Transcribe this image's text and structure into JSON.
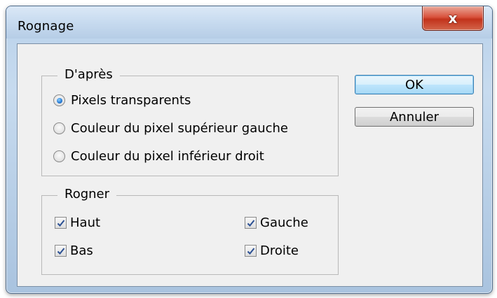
{
  "dialog": {
    "title": "Rognage",
    "close_glyph": "x"
  },
  "based_on": {
    "legend": "D'après",
    "options": [
      {
        "label": "Pixels transparents",
        "selected": true
      },
      {
        "label": "Couleur du pixel supérieur gauche",
        "selected": false
      },
      {
        "label": "Couleur du pixel inférieur droit",
        "selected": false
      }
    ]
  },
  "trim": {
    "legend": "Rogner",
    "top": {
      "label": "Haut",
      "checked": true
    },
    "bottom": {
      "label": "Bas",
      "checked": true
    },
    "left": {
      "label": "Gauche",
      "checked": true
    },
    "right": {
      "label": "Droite",
      "checked": true
    }
  },
  "buttons": {
    "ok": "OK",
    "cancel": "Annuler"
  },
  "colors": {
    "check_mark": "#2a4f93",
    "radio_selected": "#2b7fd6",
    "close_button": "#c2331c",
    "default_button_border": "#3c7fb1"
  },
  "icons": {
    "close": "close-icon",
    "check": "checkmark-icon"
  }
}
